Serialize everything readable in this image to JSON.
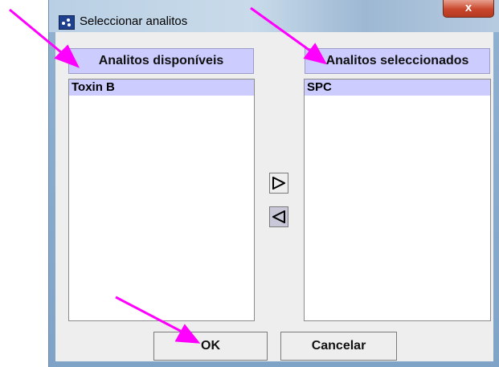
{
  "window": {
    "title": "Seleccionar analitos",
    "close_glyph": "x"
  },
  "available": {
    "header": "Analitos disponíveis",
    "items": [
      "Toxin B"
    ]
  },
  "selected": {
    "header": "Analitos seleccionados",
    "items": [
      "SPC"
    ]
  },
  "buttons": {
    "add_glyph": "▷",
    "remove_glyph": "◁",
    "ok": "OK",
    "cancel": "Cancelar"
  },
  "annotations": {
    "arrow_color": "#ff00ff"
  }
}
